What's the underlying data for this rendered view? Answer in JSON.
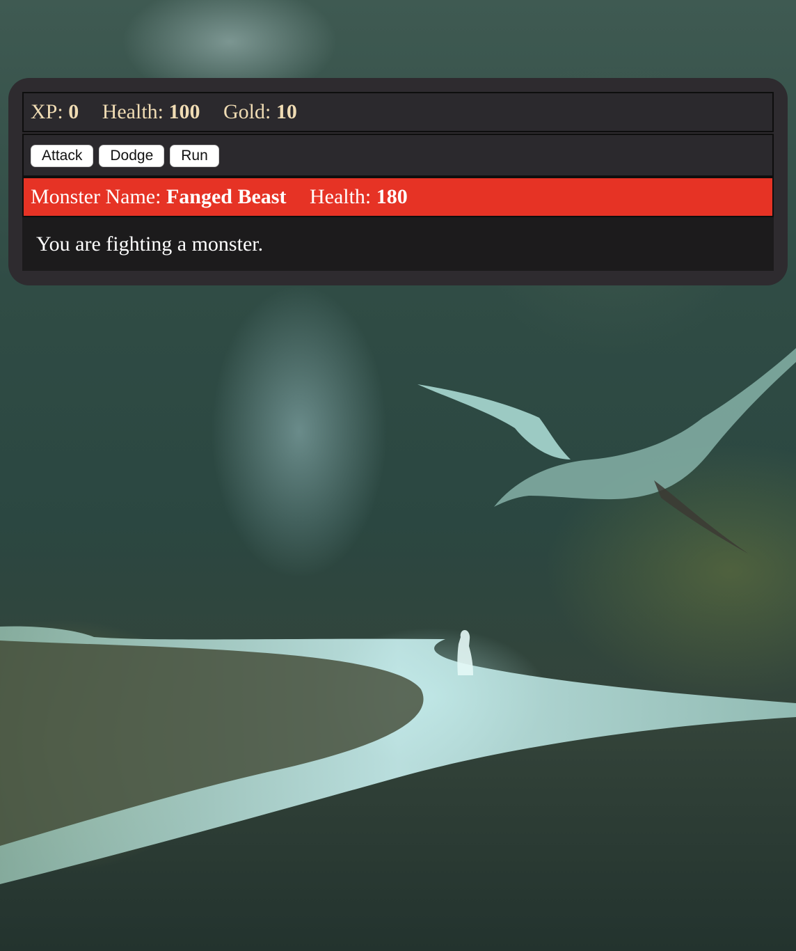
{
  "stats": {
    "xp_label": "XP:",
    "xp_value": "0",
    "health_label": "Health:",
    "health_value": "100",
    "gold_label": "Gold:",
    "gold_value": "10"
  },
  "controls": {
    "button1": "Attack",
    "button2": "Dodge",
    "button3": "Run"
  },
  "monster": {
    "name_label": "Monster Name:",
    "name_value": "Fanged Beast",
    "health_label": "Health:",
    "health_value": "180"
  },
  "text": "You are fighting a monster.",
  "colors": {
    "panel_bg": "#2e2b2f",
    "stats_text": "#f0dcb4",
    "monster_bg": "#e63325",
    "text_bg": "#1c1b1c"
  }
}
